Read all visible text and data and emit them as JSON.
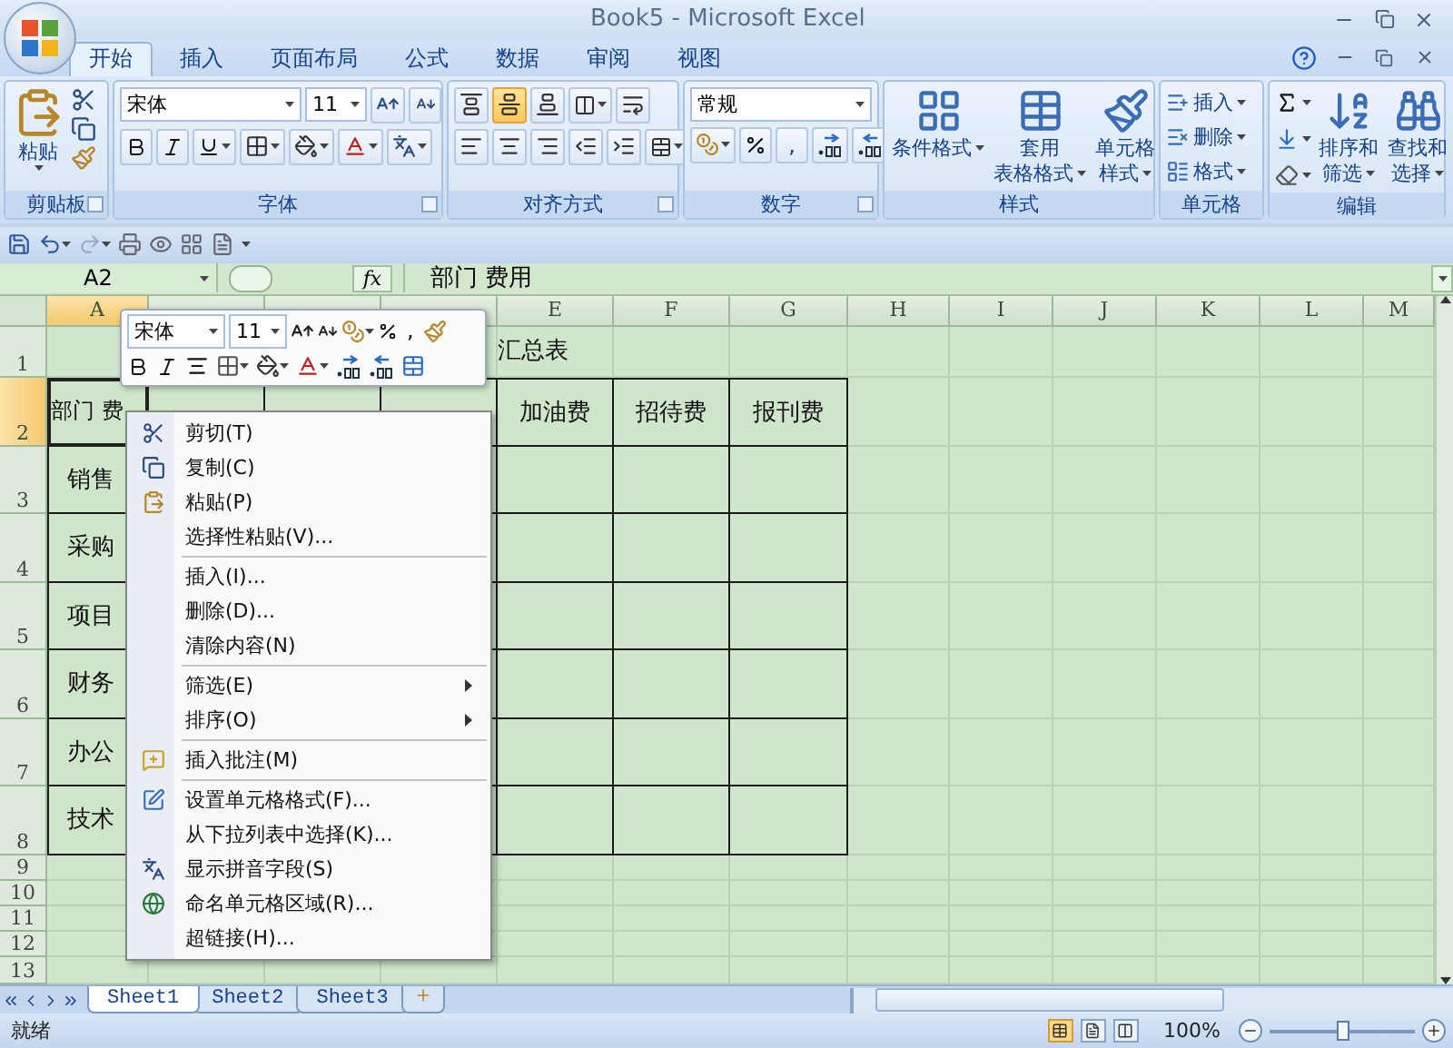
{
  "window": {
    "title": "Book5 - Microsoft Excel"
  },
  "ribbon_tabs": [
    {
      "label": "开始",
      "selected": true
    },
    {
      "label": "插入",
      "selected": false
    },
    {
      "label": "页面布局",
      "selected": false
    },
    {
      "label": "公式",
      "selected": false
    },
    {
      "label": "数据",
      "selected": false
    },
    {
      "label": "审阅",
      "selected": false
    },
    {
      "label": "视图",
      "selected": false
    }
  ],
  "ribbon": {
    "clipboard": {
      "title": "剪贴板",
      "paste": "粘贴"
    },
    "font": {
      "title": "字体",
      "font_name": "宋体",
      "font_size": "11"
    },
    "alignment": {
      "title": "对齐方式",
      "vertical": [
        {
          "selected": false
        },
        {
          "selected": true
        },
        {
          "selected": false
        }
      ]
    },
    "number": {
      "title": "数字",
      "format": "常规",
      "comma": ","
    },
    "styles": {
      "title": "样式",
      "buttons": [
        {
          "lines": [
            "条件格式"
          ]
        },
        {
          "lines": [
            "套用",
            "表格格式"
          ]
        },
        {
          "lines": [
            "单元格",
            "样式"
          ]
        }
      ]
    },
    "cells": {
      "title": "单元格",
      "buttons": [
        "插入",
        "删除",
        "格式"
      ]
    },
    "editing": {
      "title": "编辑",
      "buttons": [
        {
          "lines": [
            "排序和",
            "筛选"
          ]
        },
        {
          "lines": [
            "查找和",
            "选择"
          ]
        }
      ]
    }
  },
  "formula_bar": {
    "name_box": "A2",
    "function_label": "fx",
    "value": "部门 费用"
  },
  "sheet": {
    "columns": [
      {
        "label": "A",
        "selected": true
      },
      {
        "selected": false
      },
      {
        "selected": false
      },
      {
        "selected": false
      },
      {
        "label": "E",
        "selected": false
      },
      {
        "label": "F",
        "selected": false
      },
      {
        "label": "G",
        "selected": false
      },
      {
        "label": "H",
        "selected": false
      },
      {
        "label": "I",
        "selected": false
      },
      {
        "label": "J",
        "selected": false
      },
      {
        "label": "K",
        "selected": false
      },
      {
        "label": "L",
        "selected": false
      },
      {
        "label": "M",
        "selected": false
      }
    ],
    "rows": [
      {
        "label": "1",
        "selected": false
      },
      {
        "label": "2",
        "selected": true
      },
      {
        "label": "3",
        "selected": false
      },
      {
        "label": "4",
        "selected": false
      },
      {
        "label": "5",
        "selected": false
      },
      {
        "label": "6",
        "selected": false
      },
      {
        "label": "7",
        "selected": false
      },
      {
        "label": "8",
        "selected": false
      },
      {
        "label": "9",
        "selected": false
      },
      {
        "label": "10",
        "selected": false
      },
      {
        "label": "11",
        "selected": false
      },
      {
        "label": "12",
        "selected": false
      },
      {
        "label": "13",
        "selected": false
      }
    ],
    "title": "汇总表",
    "header_first": "部门 费",
    "header_rest": [
      "加油费",
      "招待费",
      "报刊费"
    ],
    "departments": [
      "销售",
      "采购",
      "项目",
      "财务",
      "办公",
      "技术"
    ]
  },
  "mini_toolbar": {
    "font_name": "宋体",
    "font_size": "11",
    "comma": ","
  },
  "context_menu": {
    "groups": [
      [
        {
          "label": "剪切(T)",
          "submenu": false
        },
        {
          "label": "复制(C)",
          "submenu": false
        },
        {
          "label": "粘贴(P)",
          "submenu": false
        },
        {
          "label": "选择性粘贴(V)...",
          "submenu": false
        }
      ],
      [
        {
          "label": "插入(I)...",
          "submenu": false
        },
        {
          "label": "删除(D)...",
          "submenu": false
        },
        {
          "label": "清除内容(N)",
          "submenu": false
        }
      ],
      [
        {
          "label": "筛选(E)",
          "submenu": true
        },
        {
          "label": "排序(O)",
          "submenu": true
        }
      ],
      [
        {
          "label": "插入批注(M)",
          "submenu": false
        }
      ],
      [
        {
          "label": "设置单元格格式(F)...",
          "submenu": false
        },
        {
          "label": "从下拉列表中选择(K)...",
          "submenu": false
        },
        {
          "label": "显示拼音字段(S)",
          "submenu": false
        },
        {
          "label": "命名单元格区域(R)...",
          "submenu": false
        },
        {
          "label": "超链接(H)...",
          "submenu": false
        }
      ]
    ]
  },
  "sheet_tabs": [
    {
      "label": "Sheet1",
      "selected": true
    },
    {
      "label": "Sheet2",
      "selected": false
    },
    {
      "label": "Sheet3",
      "selected": false
    }
  ],
  "status_bar": {
    "text": "就绪",
    "views": [
      {
        "selected": true
      },
      {
        "selected": false
      },
      {
        "selected": false
      }
    ],
    "zoom": "100%",
    "zoom_slider": {
      "level": 0.5
    }
  }
}
